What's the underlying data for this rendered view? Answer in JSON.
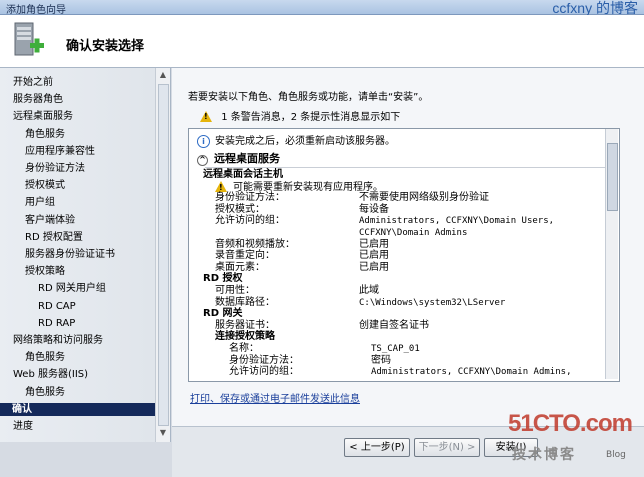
{
  "window": {
    "title": "添加角色向导",
    "watermark": "ccfxny 的博客"
  },
  "header": {
    "title": "确认安装选择"
  },
  "sidebar": {
    "items": [
      {
        "label": "开始之前",
        "level": 0
      },
      {
        "label": "服务器角色",
        "level": 0
      },
      {
        "label": "远程桌面服务",
        "level": 0
      },
      {
        "label": "角色服务",
        "level": 1
      },
      {
        "label": "应用程序兼容性",
        "level": 1
      },
      {
        "label": "身份验证方法",
        "level": 1
      },
      {
        "label": "授权模式",
        "level": 1
      },
      {
        "label": "用户组",
        "level": 1
      },
      {
        "label": "客户端体验",
        "level": 1
      },
      {
        "label": "RD 授权配置",
        "level": 1
      },
      {
        "label": "服务器身份验证证书",
        "level": 1
      },
      {
        "label": "授权策略",
        "level": 1
      },
      {
        "label": "RD 网关用户组",
        "level": 2
      },
      {
        "label": "RD CAP",
        "level": 2
      },
      {
        "label": "RD RAP",
        "level": 2
      },
      {
        "label": "网络策略和访问服务",
        "level": 0
      },
      {
        "label": "角色服务",
        "level": 1
      },
      {
        "label": "Web 服务器(IIS)",
        "level": 0
      },
      {
        "label": "角色服务",
        "level": 1
      },
      {
        "label": "确认",
        "level": 0,
        "current": true
      },
      {
        "label": "进度",
        "level": 0
      }
    ]
  },
  "main": {
    "intro": "若要安装以下角色、角色服务或功能，请单击“安装”。",
    "warning_summary": "1 条警告消息，2 条提示性消息显示如下",
    "restart_notice": "安装完成之后，必须重新启动该服务器。",
    "section_title": "远程桌面服务",
    "link_text": "打印、保存或通过电子邮件发送此信息",
    "lines": [
      {
        "text": "远程桌面会话主机",
        "bold": true,
        "indent": 0
      },
      {
        "text": "可能需要重新安装现有应用程序。",
        "warn": true,
        "indent": 1
      },
      {
        "key": "身份验证方法：",
        "value": "不需要使用网络级别身份验证",
        "indent": 1
      },
      {
        "key": "授权模式：",
        "value": "每设备",
        "indent": 1
      },
      {
        "key": "允许访问的组：",
        "value": "Administrators, CCFXNY\\Domain Users,",
        "mono": true,
        "indent": 1
      },
      {
        "key": "",
        "value": "CCFXNY\\Domain Admins",
        "mono": true,
        "indent": 1
      },
      {
        "key": "音频和视频播放：",
        "value": "已启用",
        "indent": 1
      },
      {
        "key": "录音重定向：",
        "value": "已启用",
        "indent": 1
      },
      {
        "key": "桌面元素：",
        "value": "已启用",
        "indent": 1
      },
      {
        "text": "RD 授权",
        "bold": true,
        "indent": 0
      },
      {
        "key": "可用性：",
        "value": "此域",
        "indent": 1
      },
      {
        "key": "数据库路径：",
        "value": "C:\\Windows\\system32\\LServer",
        "mono": true,
        "indent": 1
      },
      {
        "text": "RD 网关",
        "bold": true,
        "indent": 0
      },
      {
        "key": "服务器证书：",
        "value": "创建自签名证书",
        "indent": 1
      },
      {
        "text": "连接授权策略",
        "bold": true,
        "indent": 1
      },
      {
        "key": "名称：",
        "value": "TS_CAP_01",
        "mono": true,
        "indent": 2
      },
      {
        "key": "身份验证方法：",
        "value": "密码",
        "indent": 2
      },
      {
        "key": "允许访问的组：",
        "value": "Administrators, CCFXNY\\Domain Admins,",
        "mono": true,
        "indent": 2
      }
    ]
  },
  "buttons": {
    "prev": "< 上一步(P)",
    "next": "下一步(N) >",
    "install": "安装(I)"
  },
  "branding": {
    "logo": "51CTO.com",
    "sub": "技术博客",
    "blog": "Blog"
  },
  "colors": {
    "current_item_bg": "#14295a",
    "link": "#1a3f9b",
    "warning": "#e5b40b"
  }
}
